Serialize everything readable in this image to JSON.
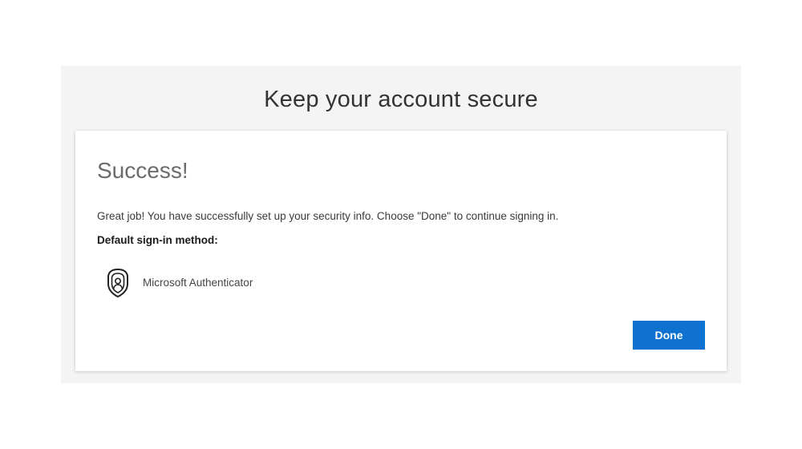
{
  "page": {
    "title": "Keep your account secure"
  },
  "card": {
    "heading": "Success!",
    "message": "Great job! You have successfully set up your security info. Choose \"Done\" to continue signing in.",
    "default_method_label": "Default sign-in method:",
    "method": {
      "name": "Microsoft Authenticator",
      "icon": "authenticator-icon"
    },
    "done_label": "Done"
  },
  "colors": {
    "accent": "#0f72d0",
    "panel_background": "#f4f4f4",
    "card_background": "#ffffff"
  }
}
